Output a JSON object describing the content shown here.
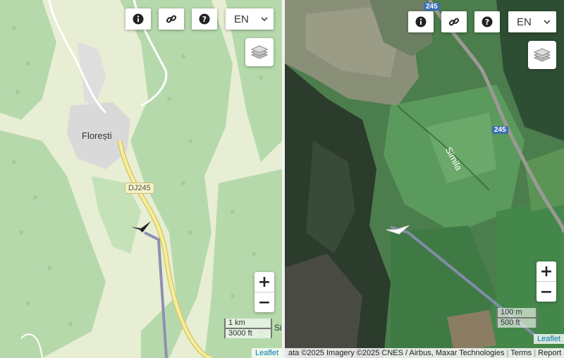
{
  "left_map": {
    "place_label": "Florești",
    "road_label": "DJ245",
    "scale_metric": "1 km",
    "scale_imperial": "3000 ft",
    "cut_label": "Si",
    "attribution_link": "Leaflet"
  },
  "right_map": {
    "place_label": "Simila",
    "road_badge_1": "245",
    "road_badge_2": "245",
    "scale_metric": "100 m",
    "scale_imperial": "500 ft",
    "attribution_link": "Leaflet",
    "attribution_text": "ata ©2025 Imagery ©2025 CNES / Airbus, Maxar Technologies",
    "terms_link": "Terms",
    "report_link": "Report a map error"
  },
  "controls": {
    "info_icon": "info-icon",
    "link_icon": "link-icon",
    "help_icon": "help-icon",
    "language_value": "EN",
    "layers_icon": "layers-icon",
    "zoom_in_label": "+",
    "zoom_out_label": "−"
  },
  "colors": {
    "map_forest": "#b8dab0",
    "map_open": "#e9efd7",
    "road_yellow": "#f4eaa0",
    "track_line": "#8f8fb0",
    "sat_forest": "#2f5f3a",
    "sat_meadow": "#4f8a52"
  }
}
